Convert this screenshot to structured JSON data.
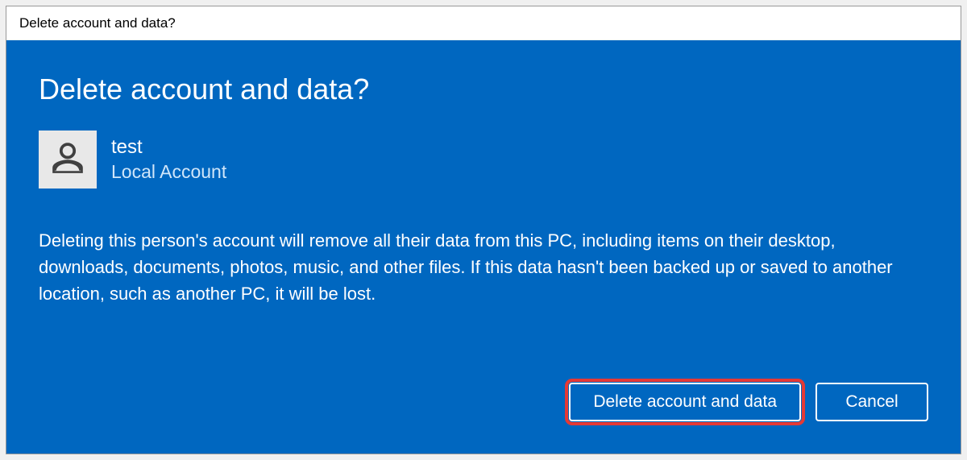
{
  "titleBar": {
    "text": "Delete account and data?"
  },
  "dialog": {
    "heading": "Delete account and data?",
    "account": {
      "name": "test",
      "type": "Local Account"
    },
    "warningText": "Deleting this person's account will remove all their data from this PC, including items on their desktop, downloads, documents, photos, music, and other files. If this data hasn't been backed up or saved to another location, such as another PC, it will be lost.",
    "buttons": {
      "confirm": "Delete account and data",
      "cancel": "Cancel"
    }
  }
}
